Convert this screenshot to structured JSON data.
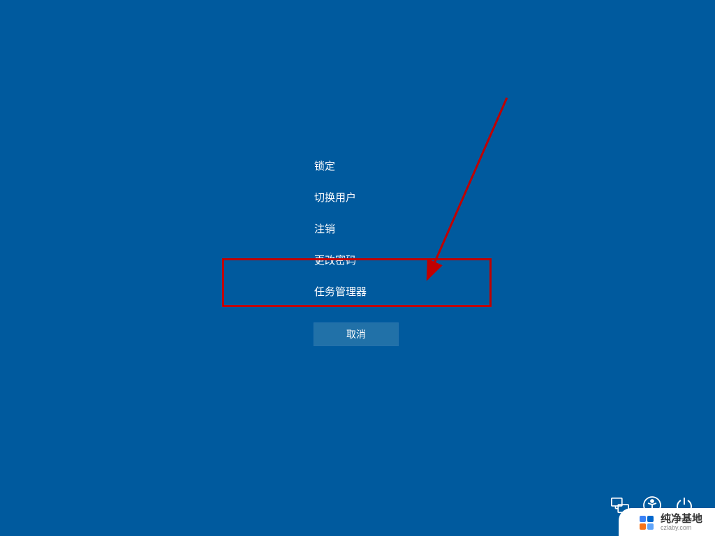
{
  "menu": {
    "items": [
      {
        "label": "锁定",
        "name": "lock-option"
      },
      {
        "label": "切换用户",
        "name": "switch-user-option"
      },
      {
        "label": "注销",
        "name": "sign-out-option"
      },
      {
        "label": "更改密码",
        "name": "change-password-option"
      },
      {
        "label": "任务管理器",
        "name": "task-manager-option"
      }
    ],
    "cancel_label": "取消"
  },
  "annotation": {
    "highlighted_item_index": 4,
    "arrow_color": "#c00000"
  },
  "watermark": {
    "title": "纯净基地",
    "url": "czlaby.com"
  },
  "colors": {
    "background": "#005a9e",
    "button": "#2171a8",
    "highlight": "#c00000"
  }
}
